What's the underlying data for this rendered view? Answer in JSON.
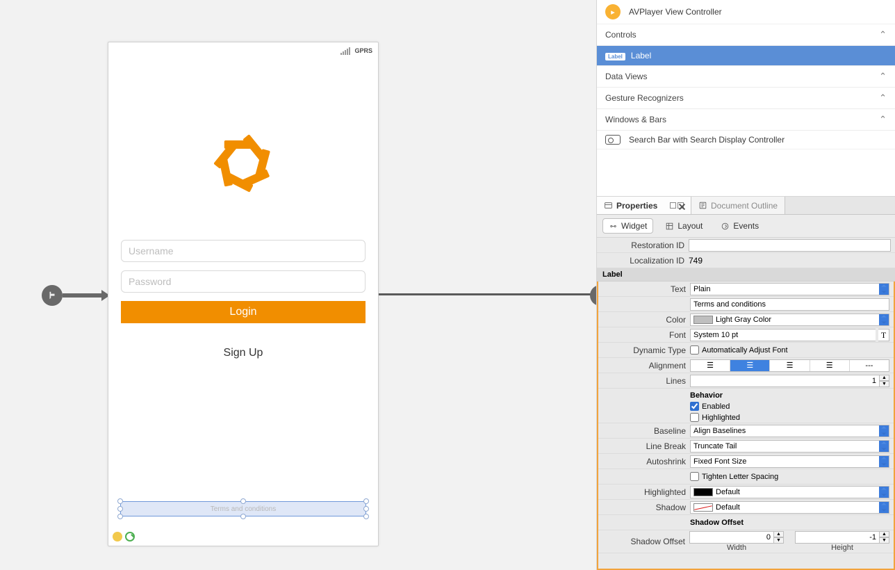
{
  "canvas": {
    "statusbar": {
      "carrier": "GPRS"
    },
    "username_placeholder": "Username",
    "password_placeholder": "Password",
    "login_label": "Login",
    "signup_label": "Sign Up",
    "terms_label": "Terms and conditions"
  },
  "library": {
    "avplayer": "AVPlayer View Controller",
    "sections": {
      "controls": "Controls",
      "label": "Label",
      "data_views": "Data Views",
      "gesture": "Gesture Recognizers",
      "windows": "Windows & Bars"
    },
    "search_bar_item": "Search Bar with Search Display Controller"
  },
  "tabs": {
    "properties": "Properties",
    "document_outline": "Document Outline",
    "widget": "Widget",
    "layout": "Layout",
    "events": "Events"
  },
  "props": {
    "restoration_id": {
      "label": "Restoration ID",
      "value": ""
    },
    "localization_id": {
      "label": "Localization ID",
      "value": "749"
    },
    "section_label": "Label",
    "text": {
      "label": "Text",
      "mode": "Plain",
      "value": "Terms and conditions"
    },
    "color": {
      "label": "Color",
      "value": "Light Gray Color"
    },
    "font": {
      "label": "Font",
      "value": "System 10 pt"
    },
    "dynamic_type": {
      "label": "Dynamic Type",
      "checkbox": "Automatically Adjust Font"
    },
    "alignment": {
      "label": "Alignment"
    },
    "lines": {
      "label": "Lines",
      "value": "1"
    },
    "behavior": {
      "label": "Behavior",
      "enabled": "Enabled",
      "highlighted": "Highlighted"
    },
    "baseline": {
      "label": "Baseline",
      "value": "Align Baselines"
    },
    "line_break": {
      "label": "Line Break",
      "value": "Truncate Tail"
    },
    "autoshrink": {
      "label": "Autoshrink",
      "value": "Fixed Font Size",
      "tighten": "Tighten Letter Spacing"
    },
    "highlighted_color": {
      "label": "Highlighted",
      "value": "Default"
    },
    "shadow": {
      "label": "Shadow",
      "value": "Default"
    },
    "shadow_offset_header": "Shadow Offset",
    "shadow_offset": {
      "label": "Shadow Offset",
      "width": "0",
      "height": "-1",
      "width_cap": "Width",
      "height_cap": "Height"
    }
  }
}
